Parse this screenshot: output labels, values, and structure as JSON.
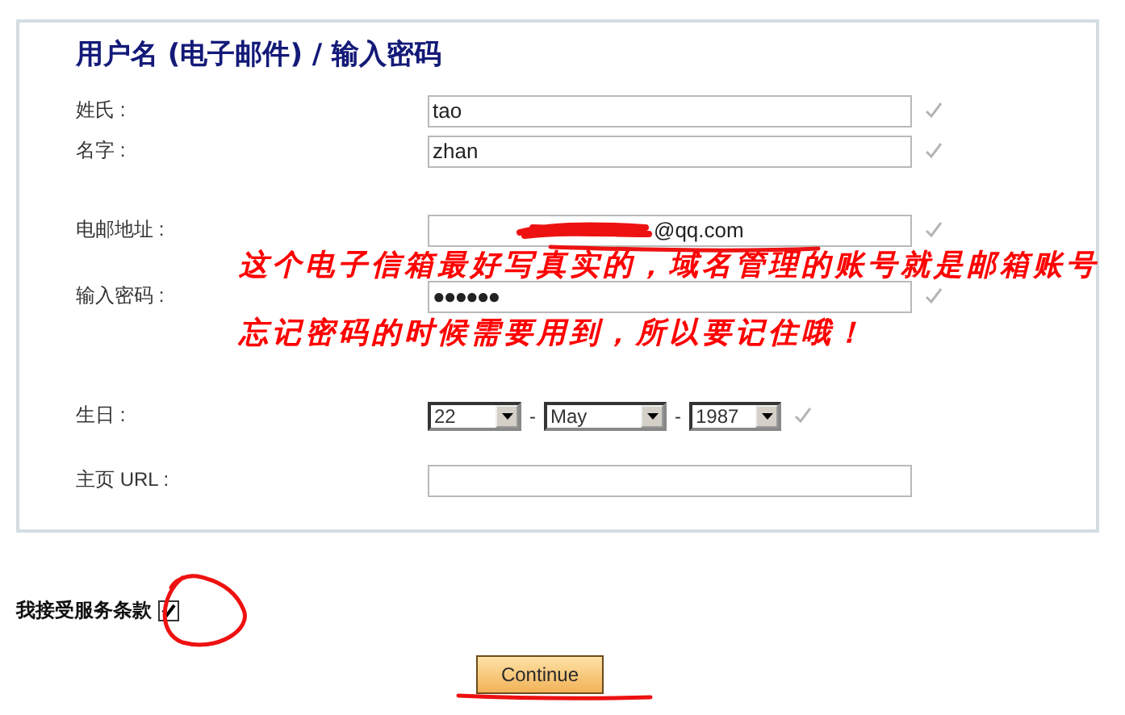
{
  "form": {
    "title": "用户名 (电子邮件) / 输入密码",
    "sections": [
      {
        "fields": [
          {
            "kind": "text",
            "label": "姓氏 :",
            "value": "tao",
            "valid": true
          },
          {
            "kind": "text",
            "label": "名字 :",
            "value": "zhan",
            "valid": true
          }
        ]
      },
      {
        "fields": [
          {
            "kind": "email",
            "label": "电邮地址 :",
            "value": "@qq.com",
            "valid": true
          },
          {
            "kind": "password",
            "label": "输入密码 :",
            "value": "●●●●●●",
            "valid": true
          }
        ]
      },
      {
        "fields": [
          {
            "kind": "date",
            "label": "生日 :",
            "parts": [
              "22",
              "May",
              "1987"
            ],
            "separators": [
              "-",
              "-"
            ],
            "valid": true
          },
          {
            "kind": "text",
            "label": "主页 URL :",
            "valid": false
          }
        ]
      }
    ]
  },
  "terms": {
    "label": "我接受服务条款",
    "checked": true
  },
  "button": {
    "label": "Continue"
  },
  "annotation": {
    "lines": [
      "这个电子信箱最好写真实的，域名管理的账号就是邮箱账号",
      "忘记密码的时候需要用到，所以要记住哦！"
    ]
  }
}
